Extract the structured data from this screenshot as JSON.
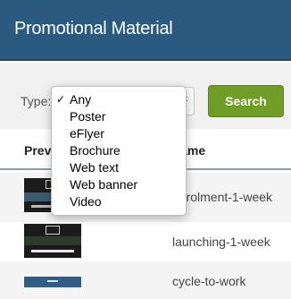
{
  "header": {
    "title": "Promotional Material"
  },
  "filter": {
    "type_label": "Type:",
    "selected": "Any",
    "search_label": "Search",
    "options": [
      "Any",
      "Poster",
      "eFlyer",
      "Brochure",
      "Web text",
      "Web banner",
      "Video"
    ],
    "check_glyph": "✓"
  },
  "table": {
    "headers": {
      "preview": "Preview",
      "name": "Name"
    },
    "rows": [
      {
        "name": "enrolment-1-week"
      },
      {
        "name": "launching-1-week"
      },
      {
        "name": "cycle-to-work"
      }
    ]
  },
  "colors": {
    "header_bg": "#2b5a81",
    "search_button": "#6f9d25"
  }
}
